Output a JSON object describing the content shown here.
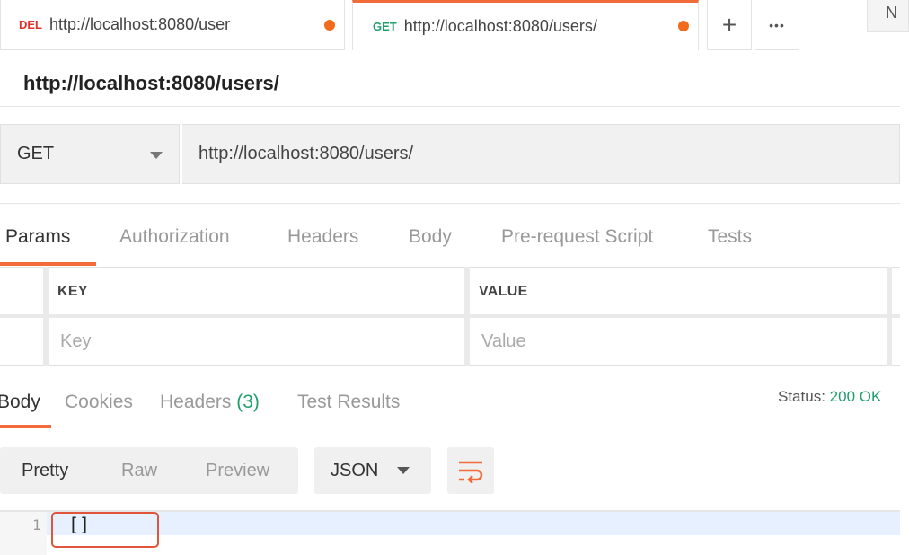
{
  "tabs": [
    {
      "method": "DEL",
      "url": "http://localhost:8080/user",
      "active": false
    },
    {
      "method": "GET",
      "url": "http://localhost:8080/users/",
      "active": true
    }
  ],
  "tab_actions": {
    "new_tab_glyph": "+",
    "more_glyph": "•••"
  },
  "partial_tab_text": "N",
  "request": {
    "title": "http://localhost:8080/users/",
    "method": "GET",
    "url": "http://localhost:8080/users/"
  },
  "request_tabs": [
    "Params",
    "Authorization",
    "Headers",
    "Body",
    "Pre-request Script",
    "Tests"
  ],
  "params_table": {
    "headers": [
      "KEY",
      "VALUE"
    ],
    "placeholders": {
      "key": "Key",
      "value": "Value"
    }
  },
  "response": {
    "tabs": {
      "body": "Body",
      "cookies": "Cookies",
      "headers": "Headers",
      "headers_count": "(3)",
      "test_results": "Test Results"
    },
    "status_label": "Status:",
    "status_value": "200 OK",
    "format_modes": [
      "Pretty",
      "Raw",
      "Preview"
    ],
    "format_type": "JSON",
    "line_number": "1",
    "code": "[]"
  },
  "colors": {
    "accent": "#f26b3a",
    "get_method": "#1f9f6b",
    "del_method": "#e0322c",
    "status_ok": "#1f9f6b"
  },
  "icons": [
    "plus-icon",
    "more-icon",
    "chevron-down-icon",
    "wrap-lines-icon",
    "unsaved-dot-icon"
  ]
}
